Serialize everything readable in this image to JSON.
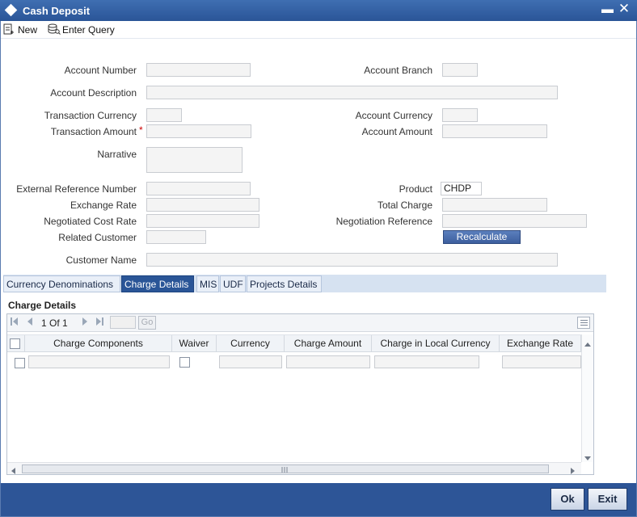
{
  "window": {
    "title": "Cash Deposit"
  },
  "toolbar": {
    "new_label": "New",
    "enter_query_label": "Enter Query"
  },
  "form": {
    "account_number": {
      "label": "Account Number",
      "value": ""
    },
    "account_branch": {
      "label": "Account Branch",
      "value": ""
    },
    "account_description": {
      "label": "Account Description",
      "value": ""
    },
    "transaction_currency": {
      "label": "Transaction Currency",
      "value": ""
    },
    "account_currency": {
      "label": "Account Currency",
      "value": ""
    },
    "transaction_amount": {
      "label": "Transaction Amount",
      "required_mark": "*",
      "value": ""
    },
    "account_amount": {
      "label": "Account Amount",
      "value": ""
    },
    "narrative": {
      "label": "Narrative",
      "value": ""
    },
    "external_reference_number": {
      "label": "External Reference Number",
      "value": ""
    },
    "product": {
      "label": "Product",
      "value": "CHDP"
    },
    "exchange_rate": {
      "label": "Exchange Rate",
      "value": ""
    },
    "total_charge": {
      "label": "Total Charge",
      "value": ""
    },
    "negotiated_cost_rate": {
      "label": "Negotiated Cost Rate",
      "value": ""
    },
    "negotiation_reference": {
      "label": "Negotiation Reference",
      "value": ""
    },
    "related_customer": {
      "label": "Related Customer",
      "value": ""
    },
    "recalculate_label": "Recalculate",
    "customer_name": {
      "label": "Customer Name",
      "value": ""
    }
  },
  "tabs": [
    {
      "label": "Currency Denominations",
      "active": false
    },
    {
      "label": "Charge Details",
      "active": true
    },
    {
      "label": "MIS",
      "active": false
    },
    {
      "label": "UDF",
      "active": false
    },
    {
      "label": "Projects Details",
      "active": false
    }
  ],
  "charge_details": {
    "section_title": "Charge Details",
    "pager": {
      "current": "1",
      "of_label": "Of",
      "total": "1",
      "go_label": "Go"
    },
    "columns": [
      "Charge Components",
      "Waiver",
      "Currency",
      "Charge Amount",
      "Charge in Local Currency",
      "Exchange Rate"
    ],
    "rows": [
      {
        "checked": false,
        "charge_component": "",
        "waiver": false,
        "currency": "",
        "charge_amount": "",
        "local_amount": "",
        "exchange_rate": ""
      }
    ]
  },
  "footer": {
    "ok_label": "Ok",
    "exit_label": "Exit"
  },
  "colors": {
    "title_bar": "#2a5597",
    "footer": "#2d5597",
    "active_tab": "#2a5597",
    "required": "#cc0000"
  }
}
